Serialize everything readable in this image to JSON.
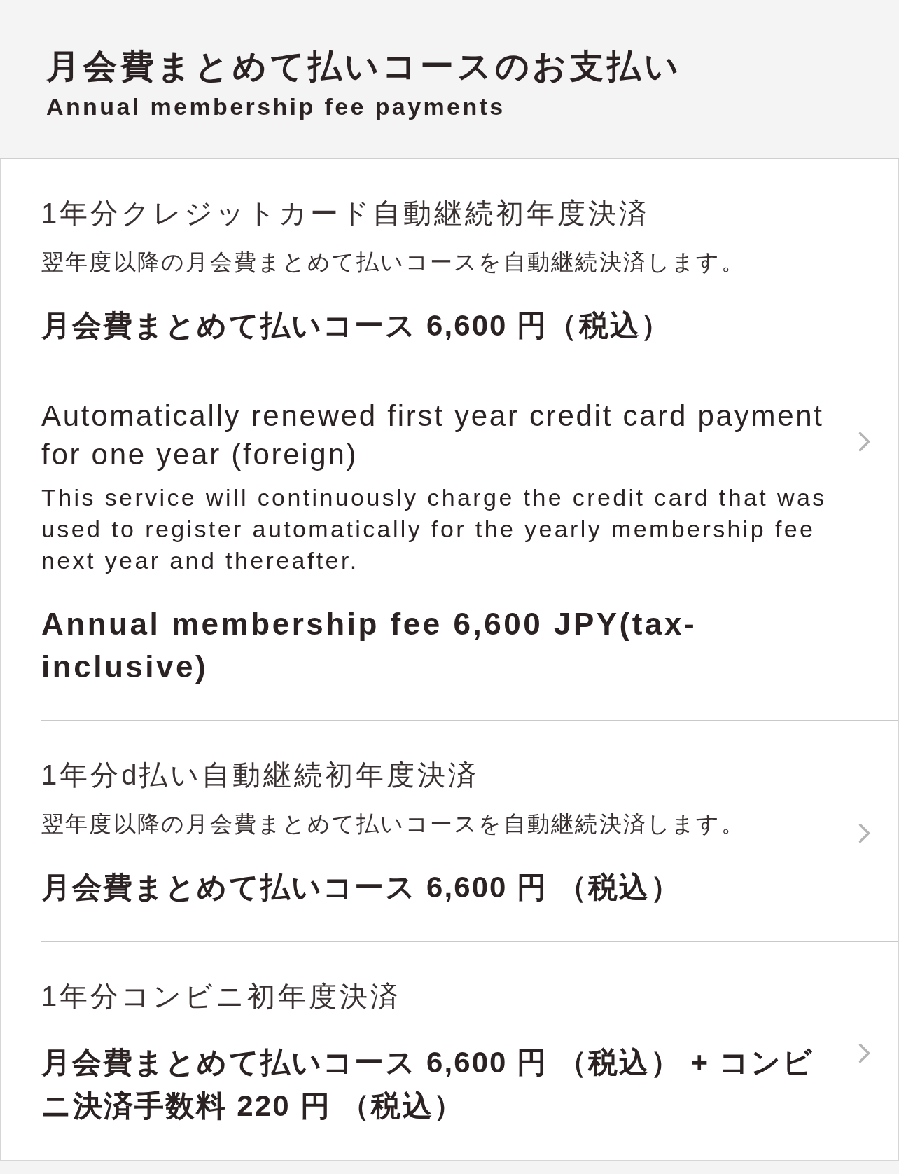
{
  "header": {
    "title": "月会費まとめて払いコースのお支払い",
    "subtitle": "Annual membership fee payments"
  },
  "options": [
    {
      "sections": [
        {
          "kind": "japanese",
          "title": "1年分クレジットカード自動継続初年度決済",
          "description": "翌年度以降の月会費まとめて払いコースを自動継続決済します。",
          "price": "月会費まとめて払いコース 6,600 円（税込）"
        },
        {
          "kind": "english",
          "title": "Automatically renewed first year credit card payment for one year (foreign)",
          "description": "This service will continuously charge the credit card that was used to register automatically for the yearly membership fee next year and thereafter.",
          "price": "Annual membership fee 6,600 JPY(tax-inclusive)"
        }
      ]
    },
    {
      "sections": [
        {
          "kind": "japanese",
          "title": "1年分d払い自動継続初年度決済",
          "description": "翌年度以降の月会費まとめて払いコースを自動継続決済します。",
          "price": "月会費まとめて払いコース 6,600 円 （税込）"
        }
      ]
    },
    {
      "sections": [
        {
          "kind": "japanese",
          "title": "1年分コンビニ初年度決済",
          "price": "月会費まとめて払いコース 6,600 円 （税込） + コンビニ決済手数料 220 円 （税込）"
        }
      ]
    }
  ]
}
